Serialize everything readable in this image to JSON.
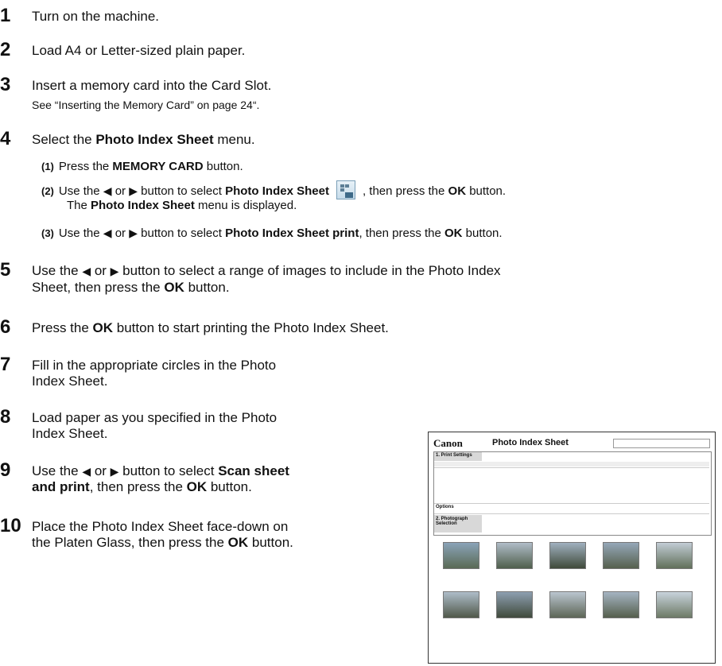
{
  "steps": [
    {
      "num": "1",
      "text": "Turn on the machine."
    },
    {
      "num": "2",
      "text": "Load A4 or Letter-sized plain paper."
    },
    {
      "num": "3",
      "text": "Insert a memory card into the Card Slot.",
      "note": "See “Inserting the Memory Card” on page 24“."
    },
    {
      "num": "4",
      "text_pre": "Select the ",
      "text_bold": "Photo Index Sheet",
      "text_post": " menu.",
      "substeps": [
        {
          "idx": "(1)",
          "pre": "Press the ",
          "bold": "MEMORY CARD",
          "post": " button."
        },
        {
          "idx": "(2)",
          "pre": "Use the ",
          "left": "◀",
          "or": " or ",
          "right": "▶",
          "mid": " button to select ",
          "bold": "Photo Index Sheet",
          "post2_pre": ", then press the ",
          "bold2": "OK",
          "post2": " button.",
          "line2_pre": "The ",
          "line2_bold": "Photo Index Sheet",
          "line2_post": " menu is displayed."
        },
        {
          "idx": "(3)",
          "pre": "Use the ",
          "left": "◀",
          "or": " or ",
          "right": "▶",
          "mid": " button to select ",
          "bold": "Photo Index Sheet print",
          "post2_pre": ", then press the ",
          "bold2": "OK",
          "post2": " button."
        }
      ]
    },
    {
      "num": "5",
      "line1_pre": "Use the ",
      "left": "◀",
      "or": " or ",
      "right": "▶",
      "line1_post": " button to select a range of images to include in the Photo Index",
      "line2_pre": "Sheet, then press the ",
      "line2_bold": "OK",
      "line2_post": " button."
    },
    {
      "num": "6",
      "pre": "Press the ",
      "bold": "OK",
      "post": " button to start printing the Photo Index Sheet."
    },
    {
      "num": "7",
      "line1": "Fill in the appropriate circles in the Photo",
      "line2": "Index Sheet."
    },
    {
      "num": "8",
      "line1": "Load paper as you specified in the Photo",
      "line2": "Index Sheet."
    },
    {
      "num": "9",
      "line1_pre": "Use the ",
      "left": "◀",
      "or": " or ",
      "right": "▶",
      "line1_mid": " button to select ",
      "line1_bold": "Scan sheet",
      "line2_bold": "and print",
      "line2_pre": ", then press the ",
      "line2_bold2": "OK",
      "line2_post": " button."
    },
    {
      "num": "10",
      "line1": "Place the Photo Index Sheet face-down on",
      "line2_pre": "the Platen Glass, then press the ",
      "line2_bold": "OK",
      "line2_post": " button."
    }
  ],
  "icons": {
    "menu": "photo-index-sheet-icon"
  },
  "sheet": {
    "logo": "Canon",
    "title": "Photo Index Sheet",
    "section1": "1. Print Settings",
    "section2": "2. Photograph Selection",
    "options": "Options"
  }
}
